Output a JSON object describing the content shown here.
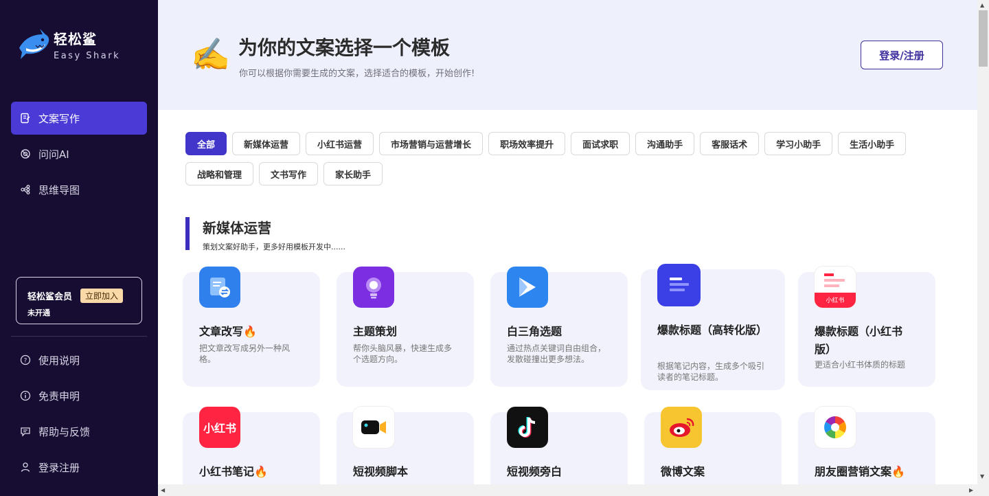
{
  "brand": {
    "name_cn": "轻松鲨",
    "name_en": "Easy Shark"
  },
  "nav": [
    {
      "label": "文案写作",
      "icon": "document-icon",
      "active": true
    },
    {
      "label": "问问AI",
      "icon": "ai-chat-icon",
      "active": false
    },
    {
      "label": "思维导图",
      "icon": "mindmap-icon",
      "active": false
    }
  ],
  "member": {
    "title": "轻松鲨会员",
    "join_label": "立即加入",
    "status": "未开通"
  },
  "bottom_nav": [
    {
      "label": "使用说明",
      "icon": "help-icon"
    },
    {
      "label": "免责申明",
      "icon": "info-icon"
    },
    {
      "label": "帮助与反馈",
      "icon": "feedback-icon"
    },
    {
      "label": "登录注册",
      "icon": "user-icon"
    }
  ],
  "header": {
    "emoji": "✍️",
    "title": "为你的文案选择一个模板",
    "subtitle": "你可以根据你需要生成的文案，选择适合的模板，开始创作!",
    "login_label": "登录/注册"
  },
  "tags": [
    "全部",
    "新媒体运营",
    "小红书运营",
    "市场营销与运营增长",
    "职场效率提升",
    "面试求职",
    "沟通助手",
    "客服话术",
    "学习小助手",
    "生活小助手",
    "战略和管理",
    "文书写作",
    "家长助手"
  ],
  "section": {
    "title": "新媒体运营",
    "subtitle": "策划文案好助手，更多好用模板开发中......"
  },
  "cards": [
    {
      "title": "文章改写🔥",
      "desc": "把文章改写成另外一种风格。",
      "icon": "rewrite-icon",
      "color": "#2f80ed"
    },
    {
      "title": "主题策划",
      "desc": "帮你头脑风暴，快速生成多个选题方向。",
      "icon": "lightbulb-icon",
      "color": "#7b2fe0"
    },
    {
      "title": "白三角选题",
      "desc": "通过热点关键词自由组合，发散碰撞出更多想法。",
      "icon": "triangle-icon",
      "color": "#2d86f0"
    },
    {
      "title": "爆款标题（高转化版）",
      "desc": "根据笔记内容，生成多个吸引读者的笔记标题。",
      "icon": "headline-icon",
      "color": "#3b3fe6"
    },
    {
      "title": "爆款标题（小红书版）",
      "desc": "更适合小红书体质的标题",
      "icon": "xhs-headline-icon",
      "color": "#ffffff"
    },
    {
      "title": "小红书笔记🔥",
      "desc": "",
      "icon": "xiaohongshu-icon",
      "color": "#ff2442",
      "icon_text": "小红书"
    },
    {
      "title": "短视频脚本",
      "desc": "",
      "icon": "video-camera-icon",
      "color": "#ffffff"
    },
    {
      "title": "短视频旁白",
      "desc": "",
      "icon": "tiktok-icon",
      "color": "#111111"
    },
    {
      "title": "微博文案",
      "desc": "",
      "icon": "weibo-icon",
      "color": "#f7c530"
    },
    {
      "title": "朋友圈营销文案🔥",
      "desc": "",
      "icon": "moments-icon",
      "color": "#ffffff"
    }
  ]
}
